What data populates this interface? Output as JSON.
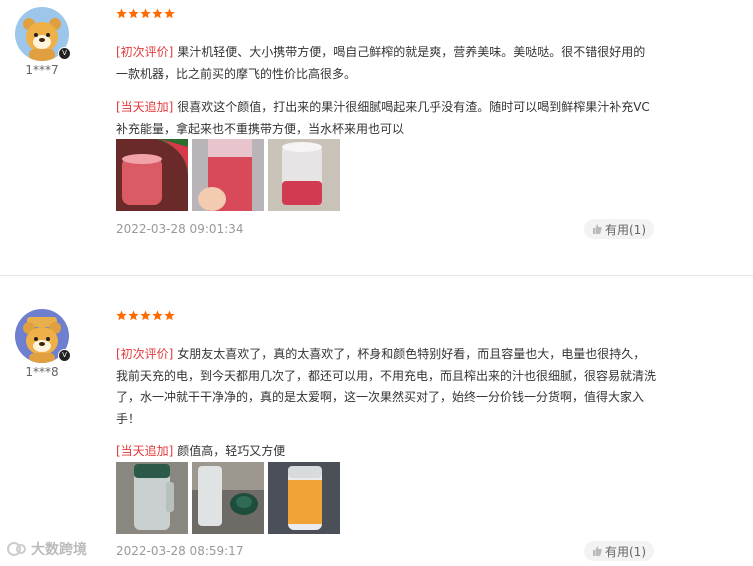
{
  "colors": {
    "accent": "#e4393c",
    "star": "#ff6a00",
    "date": "#999999"
  },
  "reviews": [
    {
      "username": "1***7",
      "rating": 5,
      "first_tag": "[初次评价]",
      "first_text": "果汁机轻便、大小携带方便，喝自己鲜榨的就是爽，营养美味。美哒哒。很不错很好用的一款机器，比之前买的摩飞的性价比高很多。",
      "followup_tag": "[当天追加]",
      "followup_text": "很喜欢这个颜值，打出来的果汁很细腻喝起来几乎没有渣。随时可以喝到鲜榨果汁补充VC补充能量，拿起来也不重携带方便，当水杯来用也可以",
      "date": "2022-03-28 09:01:34",
      "useful_label": "有用(1)"
    },
    {
      "username": "1***8",
      "rating": 5,
      "first_tag": "[初次评价]",
      "first_text": "女朋友太喜欢了，真的太喜欢了，杯身和颜色特别好看，而且容量也大，电量也很持久，我前天充的电，到今天都用几次了，都还可以用，不用充电，而且榨出来的汁也很细腻，很容易就清洗了，水一冲就干干净净的，真的是太爱啊，这一次果然买对了，始终一分价钱一分货啊，值得大家入手！",
      "followup_tag": "[当天追加]",
      "followup_text": "颜值高，轻巧又方便",
      "date": "2022-03-28 08:59:17",
      "useful_label": "有用(1)"
    }
  ],
  "watermark": "大数跨境"
}
